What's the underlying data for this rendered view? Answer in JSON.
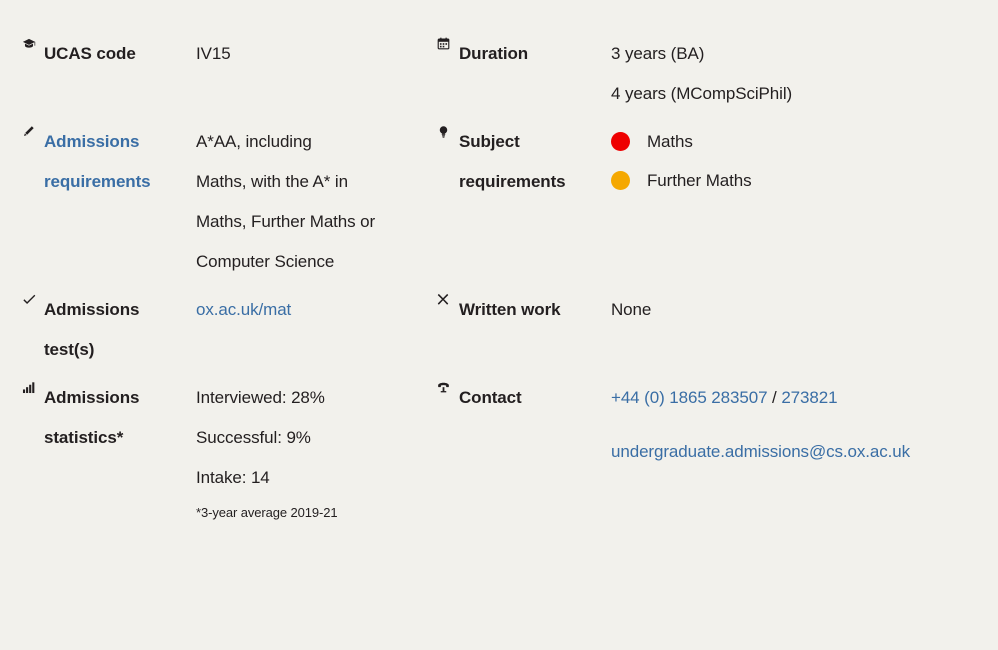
{
  "panel": {
    "background_color": "#f2f1ec",
    "text_color": "#231f20",
    "link_color": "#3a6ea5"
  },
  "facts": {
    "ucas": {
      "icon": "mortarboard-icon",
      "label": "UCAS code",
      "value": "IV15"
    },
    "duration": {
      "icon": "calendar-icon",
      "label": "Duration",
      "lines": [
        "3 years (BA)",
        "4 years (MCompSciPhil)"
      ]
    },
    "admissions_requirements": {
      "icon": "pencil-icon",
      "label_line_1": "Admissions",
      "label_line_2": "requirements",
      "lines": [
        "A*AA, including",
        "Maths, with the A* in",
        "Maths, Further Maths or",
        "Computer Science"
      ]
    },
    "subject_requirements": {
      "icon": "lightbulb-icon",
      "label_line_1": "Subject",
      "label_line_2": "requirements",
      "subjects": [
        {
          "name": "Maths",
          "color": "#ee0000",
          "level": "essential"
        },
        {
          "name": "Further Maths",
          "color": "#f5a800",
          "level": "recommended"
        }
      ]
    },
    "admissions_test": {
      "icon": "check-icon",
      "label_line_1": "Admissions",
      "label_line_2": "test(s)",
      "link_text": "ox.ac.uk/mat"
    },
    "written_work": {
      "icon": "cross-icon",
      "label": "Written work",
      "value": "None"
    },
    "admissions_statistics": {
      "icon": "bar-chart-icon",
      "label_line_1": "Admissions",
      "label_line_2": "statistics*",
      "lines": [
        "Interviewed: 28%",
        "Successful: 9%",
        "Intake: 14"
      ],
      "footnote": "*3-year average 2019-21"
    },
    "contact": {
      "icon": "telephone-icon",
      "label": "Contact",
      "phone_primary": "+44 (0) 1865 283507",
      "phone_separator": " / ",
      "phone_secondary": "273821",
      "email": "undergraduate.admissions@cs.ox.ac.uk"
    }
  }
}
